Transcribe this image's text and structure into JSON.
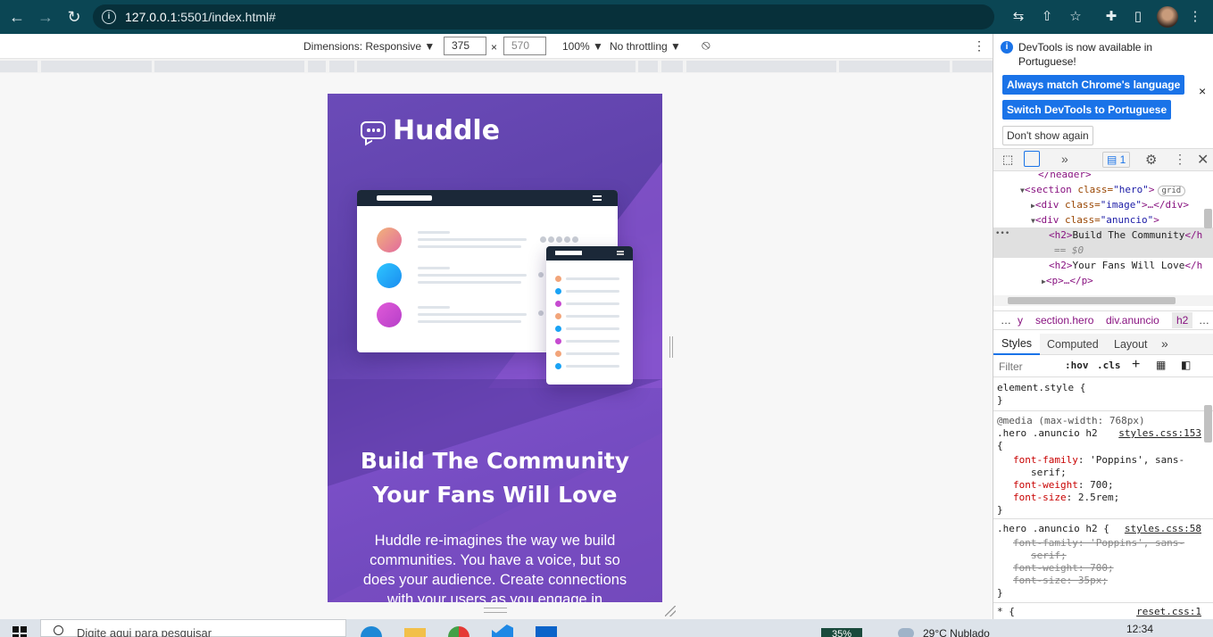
{
  "browser": {
    "url_host": "127.0.0.1",
    "url_rest": ":5501/index.html#"
  },
  "device_toolbar": {
    "dimensions_label": "Dimensions: Responsive ▼",
    "width": "375",
    "height": "570",
    "times": "×",
    "zoom": "100% ▼",
    "throttle": "No throttling ▼",
    "more": "⋮"
  },
  "site": {
    "logo_text": "Huddle",
    "heading_line1": "Build The Community",
    "heading_line2": "Your Fans Will Love",
    "paragraph": "Huddle re-imagines the way we build communities. You have a voice, but so does your audience. Create connections with your users as you engage in"
  },
  "devtools": {
    "notice_text": "DevTools is now available in Portuguese!",
    "btn_match": "Always match Chrome's language",
    "btn_switch": "Switch DevTools to Portuguese",
    "btn_dont_show": "Don't show again",
    "close": "×",
    "issues_count": "1",
    "dom": {
      "line0": "</header>",
      "line1_tag": "<section",
      "line1_attr": " class=",
      "line1_val": "\"hero\"",
      "line1_end": ">",
      "line1_badge": "grid",
      "line2_tag": "<div",
      "line2_attr": " class=",
      "line2_val": "\"image\"",
      "line2_end": ">…</div>",
      "line3_tag": "<div",
      "line3_attr": " class=",
      "line3_val": "\"anuncio\"",
      "line3_end": ">",
      "line4_open": "<h2>",
      "line4_text": "Build The Community",
      "line4_close": "</h",
      "line4_eq": "== $0",
      "line5_open": "<h2>",
      "line5_text": "Your Fans Will Love",
      "line5_close": "</h",
      "line6": "<p>…</p>",
      "ellipsis": "•••"
    },
    "breadcrumbs": [
      "…",
      "y",
      "section.hero",
      "div.anuncio",
      "h2",
      "…"
    ],
    "tabs": [
      "Styles",
      "Computed",
      "Layout",
      "»"
    ],
    "filter_placeholder": "Filter",
    "hov": ":hov",
    "cls": ".cls",
    "styles": {
      "element_style": "element.style {",
      "close_brace": "}",
      "media": "@media (max-width: 768px)",
      "rule1_selector": ".hero .anuncio h2",
      "rule1_src": "styles.css:153",
      "open_brace": "{",
      "r1_p1_name": "font-family",
      "r1_p1_val": ": 'Poppins', sans-",
      "r1_p1_cont": "serif;",
      "r1_p2_name": "font-weight",
      "r1_p2_val": ": 700;",
      "r1_p3_name": "font-size",
      "r1_p3_val": ": 2.5rem;",
      "rule2_selector": ".hero .anuncio h2 {",
      "rule2_src": "styles.css:58",
      "r2_p1": "font-family: 'Poppins', sans-",
      "r2_p1_cont": "serif;",
      "r2_p2": "font-weight: 700;",
      "r2_p3": "font-size: 35px;",
      "rule3_selector": "* {",
      "rule3_src": "reset.css:1"
    }
  },
  "taskbar": {
    "search_placeholder": "Digite aqui para pesquisar",
    "weather": "29°C  Nublado",
    "time": "12:34",
    "battery": "35%"
  },
  "colors": {
    "chrome_bar": "#0b4654",
    "huddle_purple": "#5b3fa8",
    "devtools_blue": "#1a73e8"
  }
}
